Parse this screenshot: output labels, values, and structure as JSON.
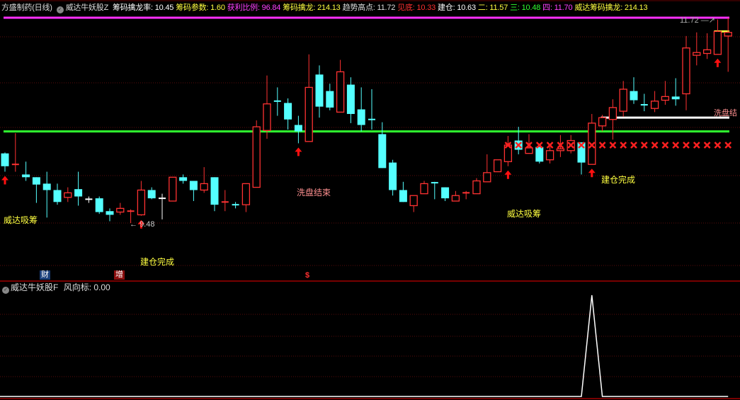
{
  "header": {
    "stock_name": "方盛制药(日线)",
    "indicator_name": "威达牛妖股Z",
    "items": [
      {
        "label": "筹码擒龙率: 10.45",
        "color": "#ffffff"
      },
      {
        "label": "筹码参数: 1.60",
        "color": "#ffff40"
      },
      {
        "label": "获利比例: 96.84",
        "color": "#ff40ff"
      },
      {
        "label": "筹码擒龙: 214.13",
        "color": "#ffff40"
      },
      {
        "label": "趋势高点: 11.72",
        "color": "#dddddd"
      },
      {
        "label": "见底: 10.33",
        "color": "#ff3030"
      },
      {
        "label": "建仓: 10.63",
        "color": "#ffffff"
      },
      {
        "label": "二: 11.57",
        "color": "#ffff40"
      },
      {
        "label": "三: 10.48",
        "color": "#30ff30"
      },
      {
        "label": "四: 11.70",
        "color": "#ff40ff"
      },
      {
        "label": "威达筹码擒龙: 214.13",
        "color": "#ffff40"
      }
    ]
  },
  "sub_header": {
    "indicator_name": "威达牛妖股F",
    "value_label": "风向标: 0.00"
  },
  "annotations": {
    "accumulate_1": "威达吸筹",
    "build_done_1": "建仓完成",
    "wash_end_1": "洗盘结束",
    "accumulate_2": "威达吸筹",
    "build_done_2": "建仓完成",
    "wash_end_2": "洗盘结",
    "high_marker": "11.72",
    "low_marker": "9.48",
    "badge_finance": "财",
    "badge_increase": "增",
    "badge_dollar": "$"
  },
  "colors": {
    "up": "#ff3232",
    "down": "#54ffff",
    "flat": "#ffffff",
    "trend_high": "#ff30ff",
    "level_three": "#30ff30",
    "build_line": "#ffffff",
    "level_two": "#ffff40"
  },
  "chart_data": [
    {
      "type": "candlestick",
      "title": "方盛制药(日线)",
      "ylim": [
        9.4,
        11.75
      ],
      "fields": [
        "open",
        "high",
        "low",
        "close"
      ],
      "candles": [
        [
          10.24,
          10.25,
          10.04,
          10.1
        ],
        [
          10.11,
          10.46,
          10.04,
          10.12
        ],
        [
          10.01,
          10.15,
          9.94,
          9.98
        ],
        [
          9.98,
          9.98,
          9.7,
          9.9
        ],
        [
          9.91,
          10.04,
          9.54,
          9.84
        ],
        [
          9.84,
          9.91,
          9.68,
          9.71
        ],
        [
          9.76,
          9.87,
          9.71,
          9.81
        ],
        [
          9.85,
          10.04,
          9.67,
          9.77
        ],
        [
          9.74,
          9.77,
          9.7,
          9.74
        ],
        [
          9.75,
          9.77,
          9.58,
          9.6
        ],
        [
          9.61,
          9.64,
          9.5,
          9.57
        ],
        [
          9.6,
          9.7,
          9.57,
          9.64
        ],
        [
          9.6,
          9.63,
          9.48,
          9.61
        ],
        [
          9.57,
          9.94,
          9.56,
          9.84
        ],
        [
          9.84,
          9.87,
          9.74,
          9.75
        ],
        [
          9.75,
          9.8,
          9.52,
          9.75
        ],
        [
          9.72,
          9.98,
          9.72,
          9.98
        ],
        [
          9.98,
          10.01,
          9.91,
          9.94
        ],
        [
          9.94,
          9.94,
          9.72,
          9.84
        ],
        [
          9.84,
          10.09,
          9.81,
          9.91
        ],
        [
          9.98,
          9.98,
          9.61,
          9.68
        ],
        [
          9.7,
          9.84,
          9.61,
          9.71
        ],
        [
          9.68,
          9.71,
          9.64,
          9.67
        ],
        [
          9.68,
          9.91,
          9.6,
          9.91
        ],
        [
          9.87,
          10.6,
          9.87,
          10.53
        ],
        [
          10.49,
          11.09,
          10.4,
          10.78
        ],
        [
          10.81,
          10.96,
          10.65,
          10.8
        ],
        [
          10.79,
          10.84,
          10.5,
          10.61
        ],
        [
          10.55,
          10.65,
          10.35,
          10.48
        ],
        [
          10.37,
          11.32,
          10.37,
          10.96
        ],
        [
          11.1,
          11.2,
          10.63,
          10.75
        ],
        [
          10.92,
          11.0,
          10.71,
          10.74
        ],
        [
          10.69,
          11.26,
          10.69,
          11.13
        ],
        [
          10.99,
          11.07,
          10.57,
          10.67
        ],
        [
          10.72,
          10.96,
          10.48,
          10.55
        ],
        [
          10.61,
          10.94,
          10.5,
          10.6
        ],
        [
          10.45,
          10.58,
          10.08,
          10.08
        ],
        [
          10.14,
          10.17,
          9.78,
          9.84
        ],
        [
          9.84,
          9.93,
          9.71,
          9.71
        ],
        [
          9.67,
          9.78,
          9.6,
          9.78
        ],
        [
          9.8,
          9.94,
          9.8,
          9.91
        ],
        [
          9.92,
          9.93,
          9.74,
          9.91
        ],
        [
          9.87,
          9.87,
          9.72,
          9.75
        ],
        [
          9.72,
          9.83,
          9.72,
          9.78
        ],
        [
          9.8,
          9.83,
          9.74,
          9.81
        ],
        [
          9.8,
          9.97,
          9.8,
          9.94
        ],
        [
          9.93,
          10.23,
          9.93,
          10.03
        ],
        [
          10.04,
          10.17,
          10.04,
          10.17
        ],
        [
          10.15,
          10.43,
          10.1,
          10.33
        ],
        [
          10.38,
          10.53,
          10.23,
          10.28
        ],
        [
          10.24,
          10.45,
          10.24,
          10.3
        ],
        [
          10.31,
          10.31,
          10.13,
          10.15
        ],
        [
          10.17,
          10.31,
          10.13,
          10.27
        ],
        [
          10.27,
          10.44,
          10.2,
          10.29
        ],
        [
          10.27,
          10.44,
          10.24,
          10.38
        ],
        [
          10.36,
          10.36,
          10.01,
          10.14
        ],
        [
          10.12,
          10.67,
          10.12,
          10.57
        ],
        [
          10.54,
          10.66,
          10.48,
          10.63
        ],
        [
          10.61,
          10.83,
          10.39,
          10.74
        ],
        [
          10.7,
          11.03,
          10.64,
          10.94
        ],
        [
          10.92,
          11.07,
          10.78,
          10.82
        ],
        [
          10.77,
          10.89,
          10.7,
          10.76
        ],
        [
          10.73,
          10.92,
          10.69,
          10.81
        ],
        [
          10.82,
          11.03,
          10.77,
          10.86
        ],
        [
          10.86,
          11.06,
          10.76,
          10.83
        ],
        [
          10.89,
          11.52,
          10.71,
          11.39
        ],
        [
          11.31,
          11.56,
          11.2,
          11.34
        ],
        [
          11.33,
          11.55,
          11.27,
          11.37
        ],
        [
          11.32,
          11.7,
          11.32,
          11.57
        ],
        [
          11.52,
          11.72,
          11.13,
          11.56
        ]
      ],
      "buy_arrows_at": [
        0,
        13,
        28,
        48,
        56,
        68
      ],
      "x_markers_from": 48,
      "x_marker_price": 10.33,
      "levels": {
        "trend_high": 11.72,
        "level_three": 10.48,
        "build": 10.63,
        "build_from": 57,
        "level_two": 11.57,
        "level_two_from": 68
      }
    },
    {
      "type": "line",
      "title": "威达牛妖股F 风向标",
      "ylim": [
        0,
        1
      ],
      "values": [
        0,
        0,
        0,
        0,
        0,
        0,
        0,
        0,
        0,
        0,
        0,
        0,
        0,
        0,
        0,
        0,
        0,
        0,
        0,
        0,
        0,
        0,
        0,
        0,
        0,
        0,
        0,
        0,
        0,
        0,
        0,
        0,
        0,
        0,
        0,
        0,
        0,
        0,
        0,
        0,
        0,
        0,
        0,
        0,
        0,
        0,
        0,
        0,
        0,
        0,
        0,
        0,
        0,
        0,
        0,
        0,
        1,
        0,
        0,
        0,
        0,
        0,
        0,
        0,
        0,
        0,
        0,
        0,
        0,
        0
      ]
    }
  ]
}
